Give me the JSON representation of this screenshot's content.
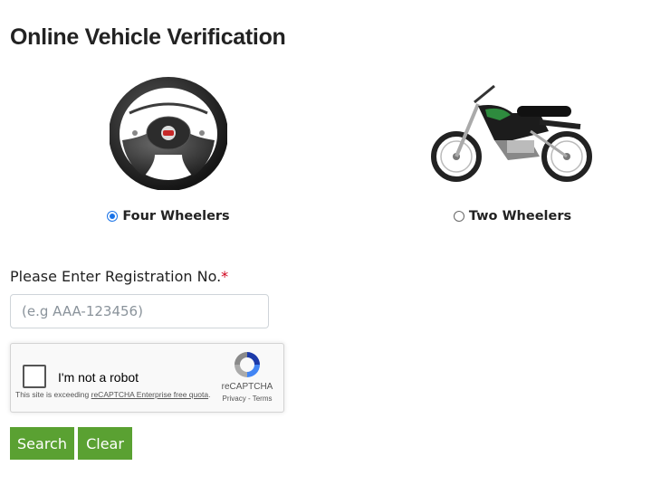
{
  "page": {
    "title": "Online Vehicle Verification"
  },
  "vehicle_types": [
    {
      "label": "Four Wheelers",
      "selected": true,
      "icon": "steering-wheel-icon"
    },
    {
      "label": "Two Wheelers",
      "selected": false,
      "icon": "motorcycle-icon"
    }
  ],
  "registration": {
    "label": "Please Enter Registration No.",
    "required_mark": "*",
    "placeholder": "(e.g AAA-123456)",
    "value": ""
  },
  "recaptcha": {
    "checkbox_label": "I'm not a robot",
    "warning_prefix": "This site is exceeding ",
    "warning_link": "reCAPTCHA Enterprise free quota",
    "warning_suffix": ".",
    "brand": "reCAPTCHA",
    "privacy": "Privacy",
    "separator": " - ",
    "terms": "Terms"
  },
  "buttons": {
    "search": "Search",
    "clear": "Clear"
  },
  "colors": {
    "button_green": "#5aa132",
    "radio_blue": "#1a73e8",
    "required_red": "#d0021b"
  }
}
